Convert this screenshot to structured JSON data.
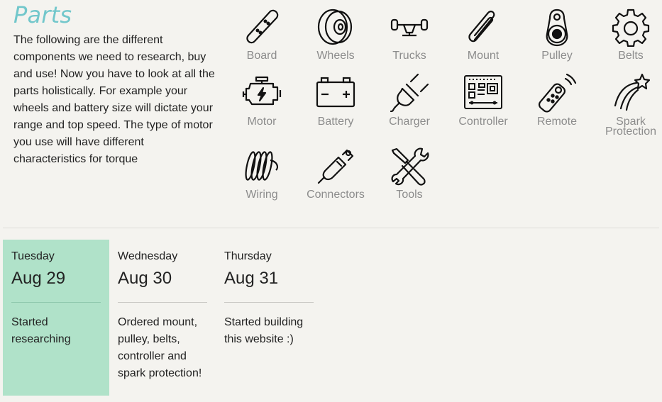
{
  "heading": "Parts",
  "intro": "The following are the different components we need to research, buy and use! Now you have to look at all the parts holistically. For example your wheels and battery size will dictate your range and top speed. The type of motor you use will have different characteristics for torque",
  "parts": [
    {
      "label": "Board",
      "icon": "skateboard-icon"
    },
    {
      "label": "Wheels",
      "icon": "wheel-icon"
    },
    {
      "label": "Trucks",
      "icon": "truck-icon"
    },
    {
      "label": "Mount",
      "icon": "paperclip-icon"
    },
    {
      "label": "Pulley",
      "icon": "pulley-icon"
    },
    {
      "label": "Belts",
      "icon": "gear-icon"
    },
    {
      "label": "Motor",
      "icon": "engine-icon"
    },
    {
      "label": "Battery",
      "icon": "battery-icon"
    },
    {
      "label": "Charger",
      "icon": "plug-icon"
    },
    {
      "label": "Controller",
      "icon": "circuit-board-icon"
    },
    {
      "label": "Remote",
      "icon": "remote-icon"
    },
    {
      "label": "Spark Protection",
      "icon": "shooting-star-icon"
    },
    {
      "label": "Wiring",
      "icon": "coil-icon"
    },
    {
      "label": "Connectors",
      "icon": "connector-icon"
    },
    {
      "label": "Tools",
      "icon": "tools-icon"
    }
  ],
  "timeline": [
    {
      "weekday": "Tuesday",
      "date": "Aug 29",
      "note": "Started researching",
      "active": true
    },
    {
      "weekday": "Wednesday",
      "date": "Aug 30",
      "note": "Ordered mount, pulley, belts, controller and spark protection!",
      "active": false
    },
    {
      "weekday": "Thursday",
      "date": "Aug 31",
      "note": "Started building this website :)",
      "active": false
    }
  ],
  "colors": {
    "heading": "#72c7cb",
    "active_day": "#b0e2c9",
    "label": "#8c8c8c",
    "background": "#f4f3ef"
  }
}
